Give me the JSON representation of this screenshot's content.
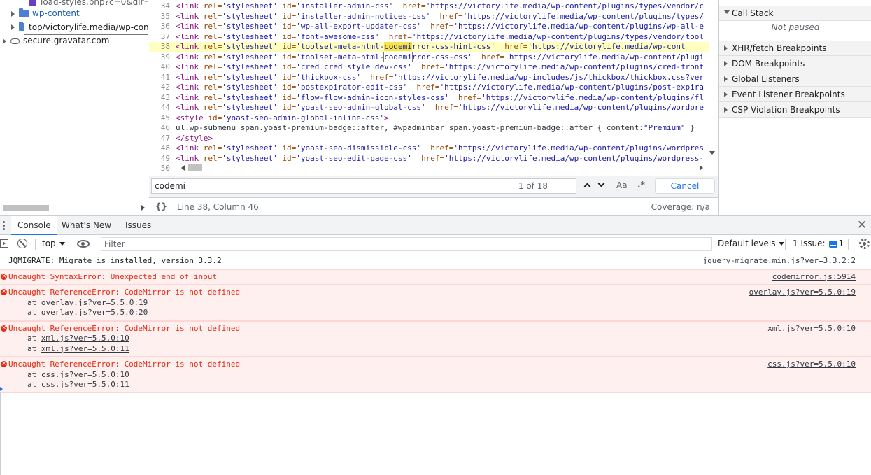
{
  "navigator": {
    "items": [
      {
        "label": "load-styles.php?c=0&dir=ltr",
        "kind": "file"
      },
      {
        "label": "wp-content",
        "kind": "folder"
      },
      {
        "label": "",
        "kind": "folder"
      },
      {
        "label": "secure.gravatar.com",
        "kind": "origin"
      }
    ],
    "tooltip": "top/victorylife.media/wp-content"
  },
  "editor": {
    "lines": [
      {
        "n": "34",
        "id": "installer-admin-css",
        "href": "'https://victorylife.media/wp-content/plugins/types/vendor/c"
      },
      {
        "n": "35",
        "id": "installer-admin-notices-css",
        "href": "'https://victorylife.media/wp-content/plugins/types/"
      },
      {
        "n": "36",
        "id": "wp-all-export-updater-css",
        "href": "'https://victorylife.media/wp-content/plugins/wp-all-e"
      },
      {
        "n": "37",
        "id": "font-awesome-css",
        "href": "'https://victorylife.media/wp-content/plugins/types/vendor/tool"
      },
      {
        "n": "38",
        "id_pre": "toolset-meta-html-",
        "id_hit": "codemi",
        "id_post": "rror-css-hint-css",
        "href": "'https://victorylife.media/wp-cont"
      },
      {
        "n": "39",
        "id_pre": "toolset-meta-html-",
        "id_hit": "codemi",
        "id_post": "rror-css-css",
        "href": "'https://victorylife.media/wp-content/plugi"
      },
      {
        "n": "40",
        "id": "cred_cred_style_dev-css",
        "href": "'https://victorylife.media/wp-content/plugins/cred-front"
      },
      {
        "n": "41",
        "id": "thickbox-css",
        "href": "'https://victorylife.media/wp-includes/js/thickbox/thickbox.css?ver"
      },
      {
        "n": "42",
        "id": "postexpirator-edit-css",
        "href": "'https://victorylife.media/wp-content/plugins/post-expira"
      },
      {
        "n": "43",
        "id": "flow-flow-admin-icon-styles-css",
        "href": "'https://victorylife.media/wp-content/plugins/fl"
      },
      {
        "n": "44",
        "id": "yoast-seo-admin-global-css",
        "href": "'https://victorylife.media/wp-content/plugins/wordpre"
      },
      {
        "n": "45",
        "raw_tag": "<style ",
        "raw_attr": "id=",
        "raw_val": "'yoast-seo-admin-global-inline-css'",
        "raw_end": ">"
      },
      {
        "n": "46",
        "plain": "ul.wp-submenu span.yoast-premium-badge::after, #wpadminbar span.yoast-premium-badge::after { content:",
        "plain_val": "\"Premium\"",
        "plain_end": "}"
      },
      {
        "n": "47",
        "raw_tag": "</style>"
      },
      {
        "n": "48",
        "id": "yoast-seo-dismissible-css",
        "href": "'https://victorylife.media/wp-content/plugins/wordpres"
      },
      {
        "n": "49",
        "id": "yoast-seo-edit-page-css",
        "href": "'https://victorylife.media/wp-content/plugins/wordpress-"
      },
      {
        "n": "50"
      }
    ],
    "tokens": {
      "open": "<link ",
      "rel_attr": "rel=",
      "rel_val": "'stylesheet'",
      "id_attr": " id=",
      "href_attr": "href="
    }
  },
  "search": {
    "query": "codemi",
    "match_count": "1 of 18",
    "case_label": "Aa",
    "regex_label": ".*",
    "cancel_label": "Cancel"
  },
  "status": {
    "pretty_print": "{}",
    "cursor_position": "Line 38, Column 46",
    "coverage": "Coverage: n/a"
  },
  "debugger": {
    "sections": [
      {
        "label": "Call Stack",
        "expanded": true
      },
      {
        "label": "XHR/fetch Breakpoints",
        "expanded": false
      },
      {
        "label": "DOM Breakpoints",
        "expanded": false
      },
      {
        "label": "Global Listeners",
        "expanded": false
      },
      {
        "label": "Event Listener Breakpoints",
        "expanded": false
      },
      {
        "label": "CSP Violation Breakpoints",
        "expanded": false
      }
    ],
    "call_stack_status": "Not paused"
  },
  "drawer": {
    "tabs": [
      "Console",
      "What's New",
      "Issues"
    ],
    "active_tab": "Console"
  },
  "console_toolbar": {
    "context": "top",
    "filter_placeholder": "Filter",
    "levels": "Default levels",
    "issues_label": "1 Issue:",
    "issues_count": "1"
  },
  "console": {
    "messages": [
      {
        "type": "log",
        "text": "JQMIGRATE: Migrate is installed, version 3.3.2",
        "source": "jquery-migrate.min.js?ver=3.3.2:2",
        "stack": []
      },
      {
        "type": "error",
        "text": "Uncaught SyntaxError: Unexpected end of input",
        "source": "codemirror.js:5914",
        "stack": []
      },
      {
        "type": "error",
        "text": "Uncaught ReferenceError: CodeMirror is not defined",
        "source": "overlay.js?ver=5.5.0:19",
        "stack": [
          "overlay.js?ver=5.5.0:19",
          "overlay.js?ver=5.5.0:20"
        ]
      },
      {
        "type": "error",
        "text": "Uncaught ReferenceError: CodeMirror is not defined",
        "source": "xml.js?ver=5.5.0:10",
        "stack": [
          "xml.js?ver=5.5.0:10",
          "xml.js?ver=5.5.0:11"
        ]
      },
      {
        "type": "error",
        "text": "Uncaught ReferenceError: CodeMirror is not defined",
        "source": "css.js?ver=5.5.0:10",
        "stack": [
          "css.js?ver=5.5.0:10",
          "css.js?ver=5.5.0:11"
        ]
      }
    ],
    "stack_prefix": "at"
  },
  "colors": {
    "accent": "#1a73e8",
    "error_text": "#e8280f",
    "error_bg": "#fff0f0",
    "highlight": "#f5e54a"
  }
}
